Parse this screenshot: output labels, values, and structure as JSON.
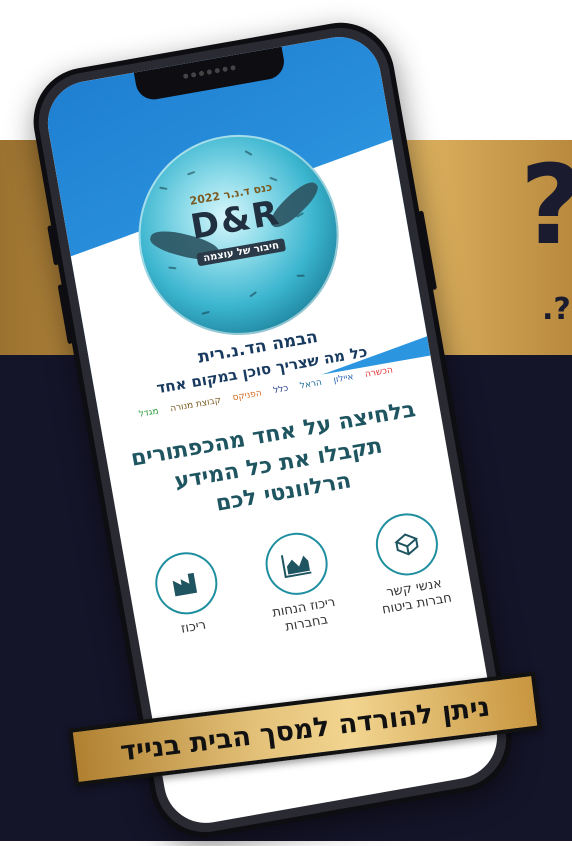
{
  "decor": {
    "qmark_large": "?",
    "qmark_small": ".?"
  },
  "logo": {
    "top": "כנס ד.נ.ר 2022",
    "main": "D&R",
    "sub": "חיבור של עוצמה"
  },
  "app": {
    "stage_title": "הבמה הד.נ.רית",
    "tagline": "כל מה שצריך סוכן במקום אחד",
    "partners": [
      "מגדל",
      "קבוצת מנורה",
      "הפניקס",
      "כלל",
      "הראל",
      "איילון",
      "הכשרה"
    ],
    "headline": "בלחיצה על אחד מהכפתורים תקבלו את כל המידע הרלוונטי לכם",
    "cards": [
      {
        "label": "אנשי קשר חברות ביטוח",
        "icon": "box-icon"
      },
      {
        "label": "ריכוז הנחות בחברות",
        "icon": "chart-icon"
      },
      {
        "label": "ריכוז",
        "icon": "factory-icon"
      }
    ]
  },
  "banner": {
    "text": "ניתן להורדה למסך הבית בנייד"
  },
  "colors": {
    "gold": "#cfa04d",
    "navy": "#15152a",
    "blue": "#2c95e0",
    "teal": "#1f8fa0"
  }
}
